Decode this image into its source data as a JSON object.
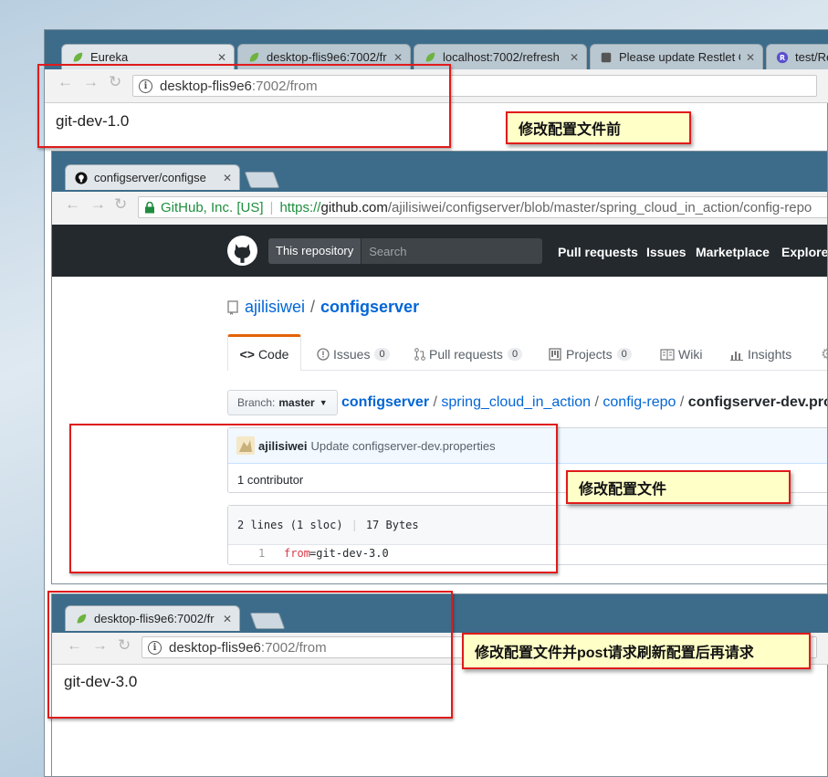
{
  "window1": {
    "tabs": [
      {
        "label": "Eureka",
        "close": "✕"
      },
      {
        "label": "desktop-flis9e6:7002/fr",
        "close": "✕"
      },
      {
        "label": "localhost:7002/refresh",
        "close": "✕"
      },
      {
        "label": "Please update Restlet C",
        "close": "✕"
      },
      {
        "label": "test/Re",
        "close": ""
      }
    ],
    "address_host": "desktop-flis9e6",
    "address_rest": ":7002/from",
    "page_text": "git-dev-1.0"
  },
  "window2": {
    "tab_label": "configserver/configse",
    "tab_close": "✕",
    "secure_label": "GitHub, Inc. [US]",
    "url_scheme": "https://",
    "url_host": "github.com",
    "url_path": "/ajilisiwei/configserver/blob/master/spring_cloud_in_action/config-repo",
    "github": {
      "scope": "This repository",
      "search_placeholder": "Search",
      "nav": [
        "Pull requests",
        "Issues",
        "Marketplace",
        "Explore"
      ],
      "owner": "ajilisiwei",
      "sep": "/",
      "repo": "configserver",
      "tabs": [
        {
          "label": "Code",
          "count": ""
        },
        {
          "label": "Issues",
          "count": "0"
        },
        {
          "label": "Pull requests",
          "count": "0"
        },
        {
          "label": "Projects",
          "count": "0"
        },
        {
          "label": "Wiki",
          "count": ""
        },
        {
          "label": "Insights",
          "count": ""
        }
      ],
      "branch_prefix": "Branch:",
      "branch": "master",
      "path": [
        "configserver",
        "spring_cloud_in_action",
        "config-repo"
      ],
      "file": "configserver-dev.prop",
      "commit_author": "ajilisiwei",
      "commit_message": "Update configserver-dev.properties",
      "contributors": "1 contributor",
      "file_info_lines": "2 lines (1 sloc)",
      "file_info_size": "17 Bytes",
      "line_number": "1",
      "code_key": "from",
      "code_rest": "=git-dev-3.0"
    }
  },
  "window3": {
    "tab_label": "desktop-flis9e6:7002/fr",
    "tab_close": "✕",
    "address_host": "desktop-flis9e6",
    "address_rest": ":7002/from",
    "page_text": "git-dev-3.0"
  },
  "notes": {
    "before": "修改配置文件前",
    "edit": "修改配置文件",
    "after": "修改配置文件并post请求刷新配置后再请求"
  },
  "colors": {
    "tabbar": "#3c6c8a",
    "github_header": "#24292e",
    "link_blue": "#0366d6",
    "callout_red": "#e01b1b",
    "callout_fill": "#ffffc8"
  }
}
